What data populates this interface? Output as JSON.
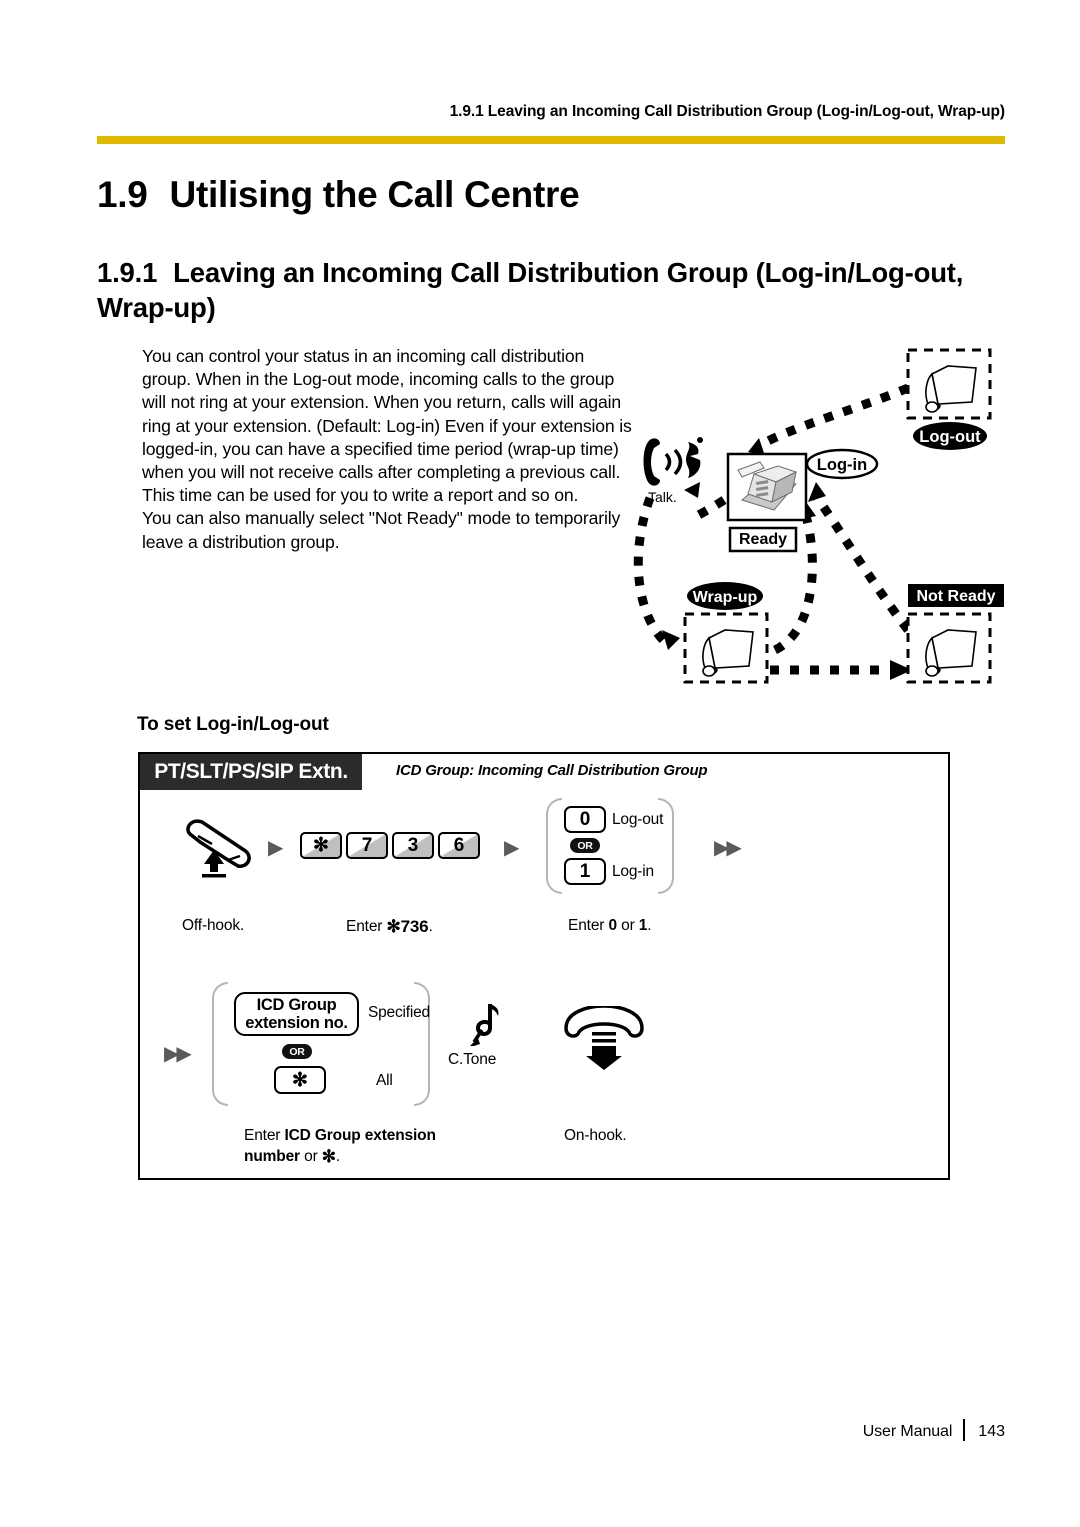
{
  "header": {
    "running_head": "1.9.1 Leaving an Incoming Call Distribution Group (Log-in/Log-out, Wrap-up)",
    "rule_color": "#e0b800"
  },
  "titles": {
    "h1_number": "1.9",
    "h1_text": "Utilising the Call Centre",
    "h2_number": "1.9.1",
    "h2_text": "Leaving an Incoming Call Distribution Group (Log-in/Log-out, Wrap-up)"
  },
  "body": {
    "paragraph_1": "You can control your status in an incoming call distribution group. When in the Log-out mode, incoming calls to the group will not ring at your extension. When you return, calls will again ring at your extension. (Default: Log-in) Even if your extension is logged-in, you can have a specified time period (wrap-up time) when you will not receive calls after completing a previous call. This time can be used for you to write a report and so on.",
    "paragraph_2": "You can also manually select \"Not Ready\" mode to temporarily leave a distribution group."
  },
  "state_diagram": {
    "talk_label": "Talk.",
    "log_out_label": "Log-out",
    "log_in_label": "Log-in",
    "ready_label": "Ready",
    "wrap_up_label": "Wrap-up",
    "not_ready_label": "Not Ready"
  },
  "sub_heading": "To set Log-in/Log-out",
  "procedure": {
    "extension_tab": "PT/SLT/PS/SIP Extn.",
    "legend": "ICD Group: Incoming Call Distribution Group",
    "or_badge": "OR",
    "row1": {
      "keys": [
        "✻",
        "7",
        "3",
        "6"
      ],
      "option_0_key": "0",
      "option_0_label": "Log-out",
      "option_1_key": "1",
      "option_1_label": "Log-in",
      "caption_offhook": "Off-hook.",
      "caption_enter_code_prefix": "Enter ",
      "caption_enter_code_value": "✻736",
      "caption_enter_code_suffix": ".",
      "caption_enter_opt_prefix": "Enter ",
      "caption_enter_opt_0": "0",
      "caption_enter_opt_mid": " or ",
      "caption_enter_opt_1": "1",
      "caption_enter_opt_suffix": "."
    },
    "row2": {
      "icd_button_line1": "ICD Group",
      "icd_button_line2": "extension no.",
      "icd_option_label": "Specified",
      "star_key": "✻",
      "star_option_label": "All",
      "tone_label": "C.Tone",
      "caption_enter_icd_prefix": "Enter ",
      "caption_enter_icd_bold1": "ICD Group extension number",
      "caption_enter_icd_mid": " or ",
      "caption_enter_icd_star": "✻",
      "caption_enter_icd_suffix": ".",
      "caption_onhook": "On-hook."
    }
  },
  "footer": {
    "manual_label": "User Manual",
    "page_number": "143"
  }
}
